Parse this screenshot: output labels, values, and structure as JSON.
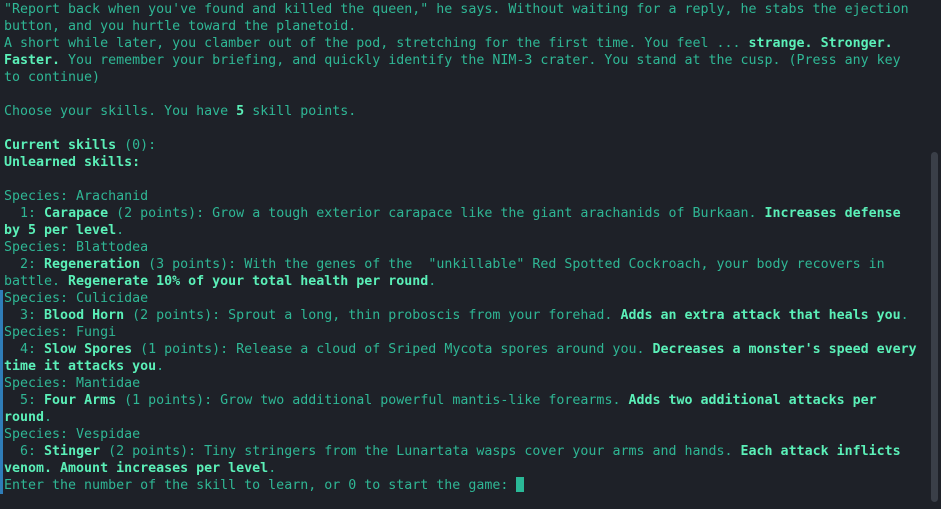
{
  "lines": [
    [
      [
        "n",
        "\"Report back when you've found and killed the queen,\" he says. Without waiting for a reply, he stabs the ejection button, and you hurtle toward the planetoid."
      ]
    ],
    [
      [
        "n",
        "A short while later, you clamber out of the pod, stretching for the first time. You feel ... "
      ],
      [
        "h",
        "strange. Stronger. Faster."
      ],
      [
        "n",
        " You remember your briefing, and quickly identify the NIM-3 crater. You stand at the cusp. (Press any key to continue)"
      ]
    ],
    [],
    [
      [
        "n",
        "Choose your skills. You have "
      ],
      [
        "h",
        "5"
      ],
      [
        "n",
        " skill points."
      ]
    ],
    [],
    [
      [
        "h",
        "Current skills"
      ],
      [
        "n",
        " (0):"
      ]
    ],
    [
      [
        "h",
        "Unlearned skills:"
      ]
    ],
    [],
    [
      [
        "n",
        "Species: Arachanid"
      ]
    ],
    [
      [
        "n",
        "  1: "
      ],
      [
        "h",
        "Carapace"
      ],
      [
        "n",
        " (2 points): Grow a tough exterior carapace like the giant arachanids of Burkaan. "
      ],
      [
        "h",
        "Increases defense by 5 per level"
      ],
      [
        "n",
        "."
      ]
    ],
    [
      [
        "n",
        "Species: Blattodea"
      ]
    ],
    [
      [
        "n",
        "  2: "
      ],
      [
        "h",
        "Regeneration"
      ],
      [
        "n",
        " (3 points): With the genes of the  \"unkillable\" Red Spotted Cockroach, your body recovers in battle. "
      ],
      [
        "h",
        "Regenerate 10% of your total health per round"
      ],
      [
        "n",
        "."
      ]
    ],
    [
      [
        "n",
        "Species: Culicidae"
      ]
    ],
    [
      [
        "n",
        "  3: "
      ],
      [
        "h",
        "Blood Horn"
      ],
      [
        "n",
        " (2 points): Sprout a long, thin proboscis from your forehad. "
      ],
      [
        "h",
        "Adds an extra attack that heals you"
      ],
      [
        "n",
        "."
      ]
    ],
    [
      [
        "n",
        "Species: Fungi"
      ]
    ],
    [
      [
        "n",
        "  4: "
      ],
      [
        "h",
        "Slow Spores"
      ],
      [
        "n",
        " (1 points): Release a cloud of Sriped Mycota spores around you. "
      ],
      [
        "h",
        "Decreases a monster's speed every time it attacks you"
      ],
      [
        "n",
        "."
      ]
    ],
    [
      [
        "n",
        "Species: Mantidae"
      ]
    ],
    [
      [
        "n",
        "  5: "
      ],
      [
        "h",
        "Four Arms"
      ],
      [
        "n",
        " (1 points): Grow two additional powerful mantis-like forearms. "
      ],
      [
        "h",
        "Adds two additional attacks per round"
      ],
      [
        "n",
        "."
      ]
    ],
    [
      [
        "n",
        "Species: Vespidae"
      ]
    ],
    [
      [
        "n",
        "  6: "
      ],
      [
        "h",
        "Stinger"
      ],
      [
        "n",
        " (2 points): Tiny stringers from the Lunartata wasps cover your arms and hands. "
      ],
      [
        "h",
        "Each attack inflicts venom. Amount increases per level"
      ],
      [
        "n",
        "."
      ]
    ]
  ],
  "prompt": "Enter the number of the skill to learn, or 0 to start the game: ",
  "colors": {
    "background": "#1e2128",
    "text": "#2fb795",
    "highlight": "#5bf0b8",
    "cursor": "#2ab897",
    "gutter_marker": "#2f7db8"
  }
}
